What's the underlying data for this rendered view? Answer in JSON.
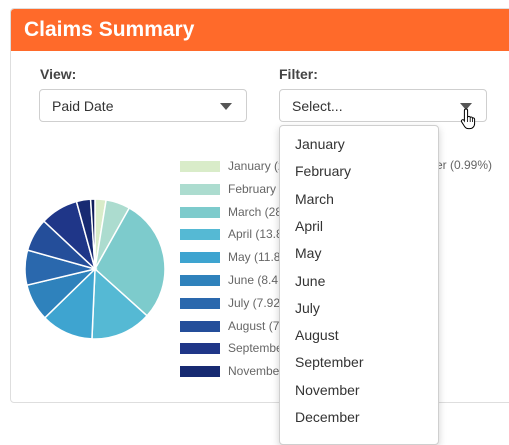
{
  "panel": {
    "title": "Claims Summary"
  },
  "view": {
    "label": "View:",
    "selected": "Paid Date"
  },
  "filter": {
    "label": "Filter:",
    "placeholder": "Select..."
  },
  "filter_options": [
    "January",
    "February",
    "March",
    "April",
    "May",
    "June",
    "July",
    "August",
    "September",
    "November",
    "December"
  ],
  "legend": [
    {
      "text": "January (2",
      "color": "#d9ecc9"
    },
    {
      "text": "February",
      "color": "#acdccf"
    },
    {
      "text": "March (28",
      "color": "#7dcbcc"
    },
    {
      "text": "April (13.8",
      "color": "#55b9d4"
    },
    {
      "text": "May (11.8",
      "color": "#3ea4d0"
    },
    {
      "text": "June (8.4",
      "color": "#2f82bc"
    },
    {
      "text": "July (7.92",
      "color": "#2a68ad"
    },
    {
      "text": "August (7",
      "color": "#244e9a"
    },
    {
      "text": "Septembe",
      "color": "#1f3688"
    },
    {
      "text": "Novembe",
      "color": "#172a72"
    }
  ],
  "legend_extra": "er (0.99%)",
  "chart_data": {
    "type": "pie",
    "slices": [
      {
        "label": "January",
        "value": 2.5,
        "color": "#d9ecc9"
      },
      {
        "label": "February",
        "value": 5.5,
        "color": "#acdccf"
      },
      {
        "label": "March",
        "value": 28,
        "color": "#7dcbcc"
      },
      {
        "label": "April",
        "value": 13.8,
        "color": "#55b9d4"
      },
      {
        "label": "May",
        "value": 11.8,
        "color": "#3ea4d0"
      },
      {
        "label": "June",
        "value": 8.42,
        "color": "#2f82bc"
      },
      {
        "label": "July",
        "value": 7.92,
        "color": "#2a68ad"
      },
      {
        "label": "August",
        "value": 7.5,
        "color": "#244e9a"
      },
      {
        "label": "September",
        "value": 8.6,
        "color": "#1f3688"
      },
      {
        "label": "November",
        "value": 3.2,
        "color": "#172a72"
      },
      {
        "label": "December",
        "value": 0.99,
        "color": "#121f5c"
      }
    ]
  }
}
